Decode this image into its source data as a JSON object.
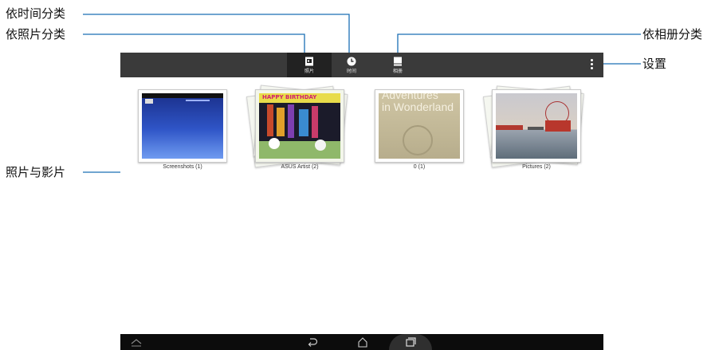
{
  "callouts": {
    "by_time": "依时间分类",
    "by_photo": "依照片分类",
    "by_album": "依相册分类",
    "settings": "设置",
    "photos_videos": "照片与影片"
  },
  "actionbar": {
    "tabs": [
      {
        "label": "照片",
        "icon": "photo-icon",
        "active": true
      },
      {
        "label": "时间",
        "icon": "clock-icon",
        "active": false
      },
      {
        "label": "相册",
        "icon": "album-icon",
        "active": false
      }
    ],
    "menu_icon": "overflow-menu-icon"
  },
  "albums": [
    {
      "caption": "Screenshots (1)"
    },
    {
      "caption": "ASUS Artist (2)",
      "thumb_text": "HAPPY BIRTHDAY"
    },
    {
      "caption": "0 (1)",
      "thumb_text_1": "Adventures",
      "thumb_text_2": "in Wonderland"
    },
    {
      "caption": "Pictures (2)"
    }
  ],
  "navbar": {
    "icons": [
      "collapse-icon",
      "back-icon",
      "home-icon",
      "recent-apps-icon"
    ]
  },
  "colors": {
    "actionbar": "#3a3a3a",
    "callout_line": "#1b6fb5",
    "navbar": "#0c0c0c"
  }
}
